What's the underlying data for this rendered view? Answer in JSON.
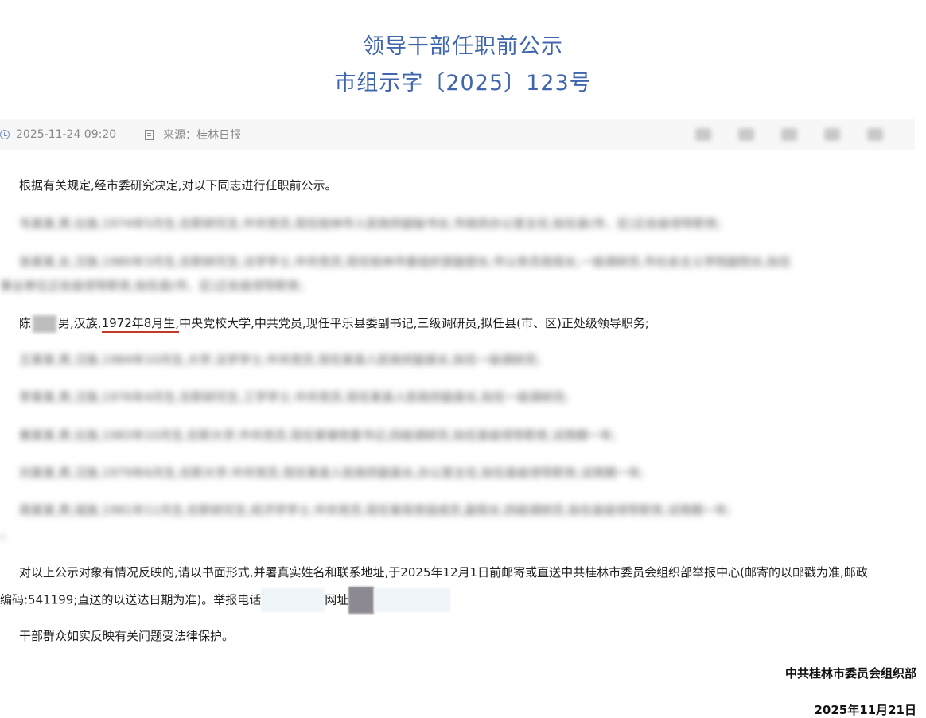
{
  "header": {
    "title": "领导干部任职前公示",
    "doc_number": "市组示字〔2025〕123号"
  },
  "meta": {
    "datetime": "2025-11-24 09:20",
    "source": "来源：桂林日报"
  },
  "body": {
    "intro": "根据有关规定,经市委研究决定,对以下同志进行任职前公示。",
    "blurred_1": "韦某某,男,壮族,1974年5月生,在职研究生,中共党员,现任桂林市人民政府副秘书长,市政府办公室主任,拟任县(市、区)正处级领导职务;",
    "blurred_2a": "张某某,女,汉族,1980年3月生,在职研究生,法学学士,中共党员,现任桂林市委组织部副部长,市公务员局局长,一级调研员,市社会主义学院副院长,拟任",
    "blurred_2b": "事业单位正处级领导职务,拟任县(市、区)正处级领导职务;",
    "person3_name_start": "陈",
    "person3_text1": "男,汉族,",
    "person3_birth": "1972年8月生,",
    "person3_text2": "中央党校大学,中共党员,现任平乐县委副书记,三级调研员,拟任县(市、区)正处级领导职务;",
    "blurred_4": "王某某,男,汉族,1984年10月生,大学,法学学士,中共党员,现任某县人民政府副县长,拟任一级调研员;",
    "blurred_5": "李某某,男,汉族,1976年4月生,在职研究生,工学学士,中共党员,现任某县人民政府副县长,拟任一级调研员;",
    "blurred_6": "黄某某,男,壮族,1983年10月生,在职大学,中共党员,现任某镇党委书记,四级调研员,拟任县级领导职务,试用期一年;",
    "blurred_7": "刘某某,男,汉族,1979年6月生,在职大学,中共党员,现任某县人民政府副县长,办公室主任,拟任县级领导职务,试用期一年;",
    "blurred_8a": "周某某,男,瑶族,1981年11月生,在职研究生,经济学学士,中共党员,现任某局党组成员,副局长,四级调研员,拟任县级领导职务,试用期一年;",
    "blurred_8b": "。",
    "report_line1": "对以上公示对象有情况反映的,请以书面形式,并署真实姓名和联系地址,于2025年12月1日前邮寄或直送中共桂林市委员会组织部举报中心(邮寄的以邮戳为准,邮政",
    "report_line2a": "编码:541199;直送的以送达日期为准)。举报电话",
    "report_line2b": "网址",
    "protection": "干部群众如实反映有关问题受法律保护。"
  },
  "signature": {
    "org": "中共桂林市委员会组织部",
    "date": "2025年11月21日"
  },
  "colors": {
    "title": "#3f66ad",
    "underline": "#c0392b"
  },
  "icons": [
    "clock-icon",
    "document-icon"
  ]
}
